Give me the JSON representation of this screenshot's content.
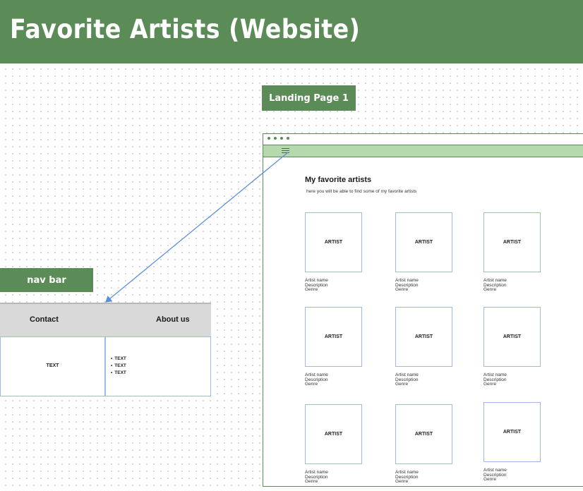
{
  "header": {
    "title": "Favorite Artists (Website)"
  },
  "labels": {
    "landing_page": "Landing Page 1",
    "nav_bar": "nav bar"
  },
  "landing": {
    "title": "My favorite artists",
    "subtitle": "here you will be able to find some of my favorite artists",
    "cards": [
      {
        "label": "ARTIST",
        "name": "Artist name",
        "description": "Description",
        "genre": "Genre"
      },
      {
        "label": "ARTIST",
        "name": "Artist name",
        "description": "Description",
        "genre": "Genre"
      },
      {
        "label": "ARTIST",
        "name": "Artist name",
        "description": "Description",
        "genre": "Genre"
      },
      {
        "label": "ARTIST",
        "name": "Artist name",
        "description": "Description",
        "genre": "Genre"
      },
      {
        "label": "ARTIST",
        "name": "Artist name",
        "description": "Description",
        "genre": "Genre"
      },
      {
        "label": "ARTIST",
        "name": "Artist name",
        "description": "Description",
        "genre": "Genre"
      },
      {
        "label": "ARTIST",
        "name": "Artist name",
        "description": "Description",
        "genre": "Genre"
      },
      {
        "label": "ARTIST",
        "name": "Artist name",
        "description": "Description",
        "genre": "Genre"
      },
      {
        "label": "ARTIST",
        "name": "Artist name",
        "description": "Description",
        "genre": "Genre"
      }
    ]
  },
  "navbar": {
    "links": [
      "Contact",
      "About us"
    ],
    "left_panel_text": "TEXT",
    "right_panel_items": [
      "TEXT",
      "TEXT",
      "TEXT"
    ]
  },
  "colors": {
    "header_green": "#5b8c57",
    "browser_bar": "#b5d9ad",
    "card_border": "#9fb8e6",
    "connector": "#5b8de0",
    "nav_bar_bg": "#d9d9d9"
  },
  "icons": {
    "menu": "hamburger-menu-icon",
    "window_dots": "window-dots-icon"
  }
}
